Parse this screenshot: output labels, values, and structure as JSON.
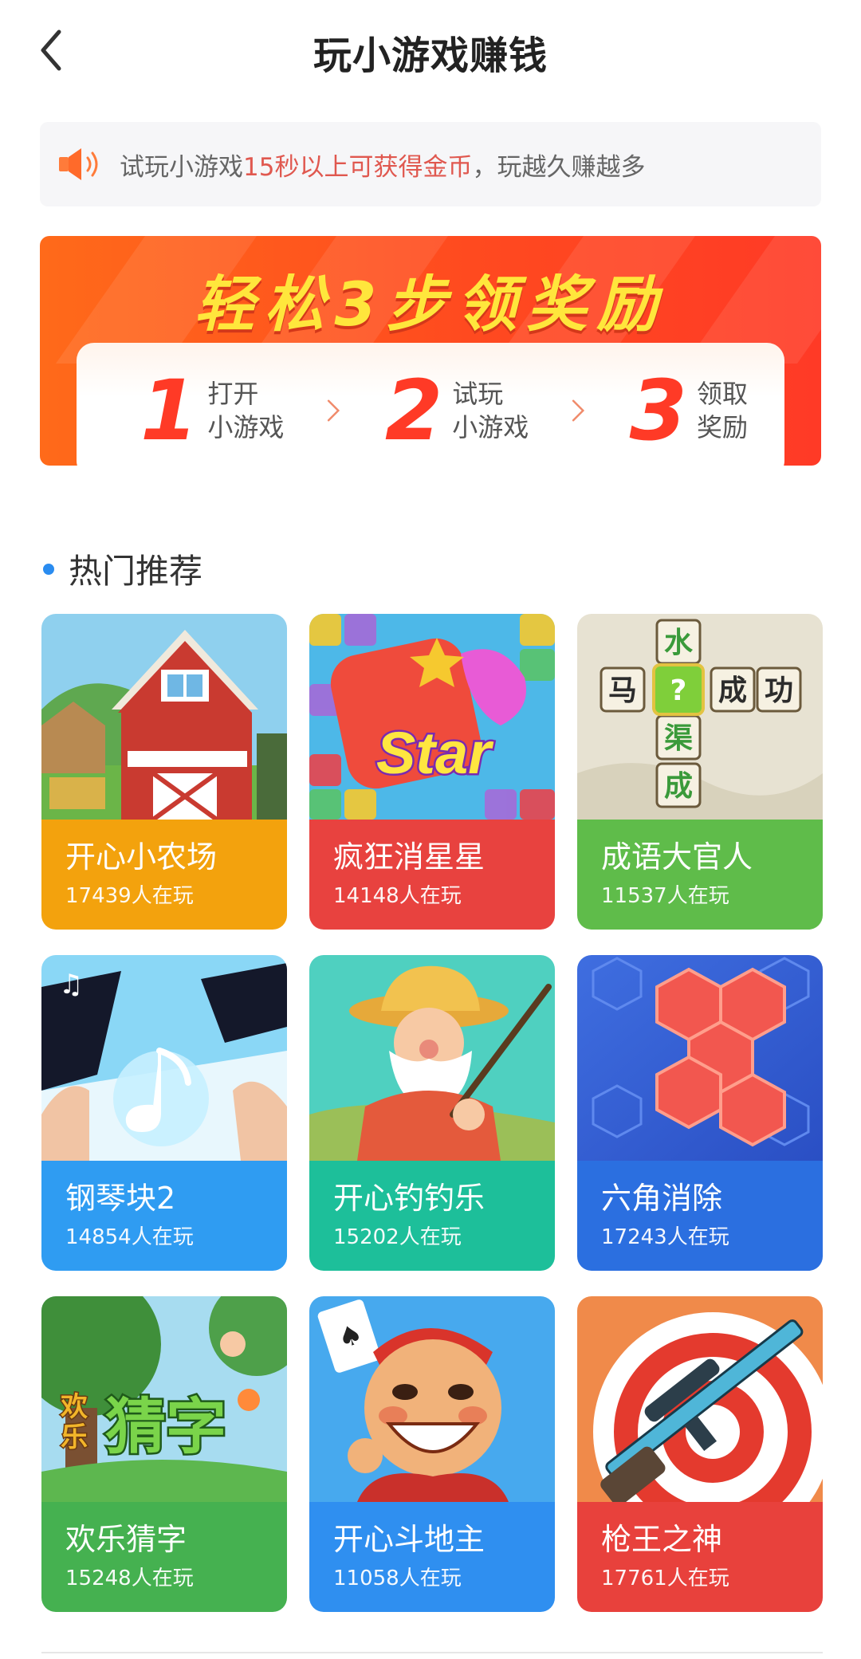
{
  "header": {
    "title": "玩小游戏赚钱",
    "back_icon": "chevron-left-icon"
  },
  "notice": {
    "icon": "speaker-icon",
    "text_prefix": "试玩小游戏",
    "text_highlight": "15秒以上可获得金币",
    "text_suffix": "，玩越久赚越多",
    "highlight_color": "#e0584f"
  },
  "banner": {
    "title": "轻松3步领奖励",
    "steps": [
      {
        "number": "1",
        "line1": "打开",
        "line2": "小游戏"
      },
      {
        "number": "2",
        "line1": "试玩",
        "line2": "小游戏"
      },
      {
        "number": "3",
        "line1": "领取",
        "line2": "奖励"
      }
    ]
  },
  "section": {
    "title": "热门推荐",
    "dot_color": "#2a8cf0"
  },
  "games": [
    {
      "name": "开心小农场",
      "players": "17439人在玩",
      "color": "#f3a20d",
      "icon": "farm-barn-icon"
    },
    {
      "name": "疯狂消星星",
      "players": "14148人在玩",
      "color": "#e8423f",
      "icon": "star-blocks-icon"
    },
    {
      "name": "成语大官人",
      "players": "11537人在玩",
      "color": "#5fbc4a",
      "icon": "idiom-puzzle-icon"
    },
    {
      "name": "钢琴块2",
      "players": "14854人在玩",
      "color": "#2f9cf2",
      "icon": "piano-tiles-icon"
    },
    {
      "name": "开心钓钓乐",
      "players": "15202人在玩",
      "color": "#1dbf9a",
      "icon": "fisherman-icon"
    },
    {
      "name": "六角消除",
      "players": "17243人在玩",
      "color": "#2b6fe0",
      "icon": "hexagon-puzzle-icon"
    },
    {
      "name": "欢乐猜字",
      "players": "15248人在玩",
      "color": "#45b150",
      "icon": "guess-word-icon"
    },
    {
      "name": "开心斗地主",
      "players": "11058人在玩",
      "color": "#2f8ff0",
      "icon": "doudizhu-character-icon"
    },
    {
      "name": "枪王之神",
      "players": "17761人在玩",
      "color": "#e8413c",
      "icon": "sniper-rifle-icon"
    }
  ],
  "idiom_chars": {
    "top": "水",
    "left": "马",
    "center": "?",
    "right1": "成",
    "right2": "功",
    "below1": "渠",
    "below2": "成"
  },
  "star_logo": "Star",
  "guess_logo": {
    "small1": "欢",
    "small2": "乐",
    "big": "猜字"
  }
}
